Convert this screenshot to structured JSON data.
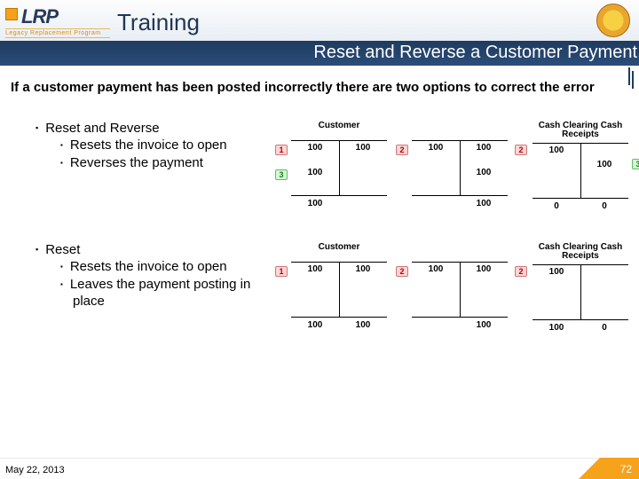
{
  "header": {
    "logo_text": "LRP",
    "logo_sub": "Legacy Replacement Program",
    "training": "Training",
    "subtitle": "Reset and Reverse a Customer Payment"
  },
  "intro": "If a customer payment has been posted incorrectly there are two options to correct the error",
  "section1": {
    "title": "Reset and Reverse",
    "sub1": "Resets the invoice to open",
    "sub2": "Reverses the payment"
  },
  "section2": {
    "title": "Reset",
    "sub1": "Resets the invoice to open",
    "sub2": "Leaves the payment posting in place"
  },
  "taccounts": {
    "acc1": {
      "title": "Customer",
      "cells": [
        {
          "side": "l",
          "row": 0,
          "val": "100"
        },
        {
          "side": "r",
          "row": 0,
          "val": "100"
        },
        {
          "side": "l",
          "row": 1,
          "val": "100"
        }
      ],
      "tot_l": "100",
      "tot_r": ""
    },
    "acc2": {
      "title": "",
      "cells": [
        {
          "side": "l",
          "row": 0,
          "val": "100"
        },
        {
          "side": "r",
          "row": 0,
          "val": "100"
        },
        {
          "side": "r",
          "row": 1,
          "val": "100"
        }
      ],
      "tot_l": "",
      "tot_r": "100"
    },
    "acc3": {
      "title": "Cash Clearing Cash Receipts",
      "cells": [
        {
          "side": "l",
          "row": 0,
          "val": "100"
        },
        {
          "side": "r",
          "row": 1,
          "val": "100"
        }
      ],
      "tot_l": "0",
      "tot_r": "0"
    },
    "bubble1": "1",
    "bubble2": "2",
    "bubble3": "3"
  },
  "taccounts2": {
    "acc1": {
      "title": "Customer",
      "cells": [
        {
          "side": "l",
          "row": 0,
          "val": "100"
        },
        {
          "side": "r",
          "row": 0,
          "val": "100"
        }
      ],
      "tot_l": "100",
      "tot_r": "100"
    },
    "acc2": {
      "title": "",
      "cells": [
        {
          "side": "l",
          "row": 0,
          "val": "100"
        },
        {
          "side": "r",
          "row": 0,
          "val": "100"
        }
      ],
      "tot_l": "",
      "tot_r": "100"
    },
    "acc3": {
      "title": "Cash Clearing Cash Receipts",
      "cells": [
        {
          "side": "l",
          "row": 0,
          "val": "100"
        }
      ],
      "tot_l": "100",
      "tot_r": "0"
    },
    "bubble1": "1",
    "bubble2": "2"
  },
  "footer": {
    "date": "May 22, 2013",
    "page": "72"
  }
}
